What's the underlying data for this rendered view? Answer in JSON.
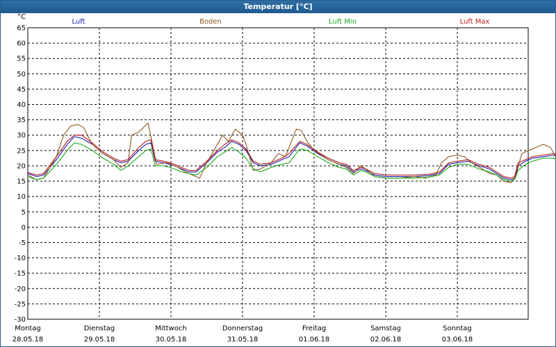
{
  "window": {
    "title": "Temperatur [°C]"
  },
  "chart_data": {
    "type": "line",
    "unit": "°C",
    "ylim": [
      -30,
      65
    ],
    "yticks": [
      65,
      60,
      55,
      50,
      45,
      40,
      35,
      30,
      25,
      20,
      15,
      10,
      5,
      0,
      -5,
      -10,
      -15,
      -20,
      -25,
      -30
    ],
    "grid": true,
    "legend_position": "top",
    "x_days": [
      {
        "weekday": "Montag",
        "date": "28.05.18"
      },
      {
        "weekday": "Dienstag",
        "date": "29.05.18"
      },
      {
        "weekday": "Mittwoch",
        "date": "30.05.18"
      },
      {
        "weekday": "Donnerstag",
        "date": "31.05.18"
      },
      {
        "weekday": "Freitag",
        "date": "01.06.18"
      },
      {
        "weekday": "Samstag",
        "date": "02.06.18"
      },
      {
        "weekday": "Sonntag",
        "date": "03.06.18"
      }
    ],
    "series": [
      {
        "name": "Luft",
        "color": "#1a1aa8",
        "points": [
          [
            0,
            17.5
          ],
          [
            0.12,
            16.5
          ],
          [
            0.22,
            17
          ],
          [
            0.4,
            22
          ],
          [
            0.55,
            27
          ],
          [
            0.65,
            29.5
          ],
          [
            0.75,
            29
          ],
          [
            0.9,
            27
          ],
          [
            1.05,
            24
          ],
          [
            1.2,
            22
          ],
          [
            1.3,
            21
          ],
          [
            1.4,
            21.5
          ],
          [
            1.55,
            25
          ],
          [
            1.65,
            27
          ],
          [
            1.72,
            27.5
          ],
          [
            1.78,
            21.5
          ],
          [
            1.9,
            21
          ],
          [
            2.05,
            20
          ],
          [
            2.15,
            19
          ],
          [
            2.25,
            18
          ],
          [
            2.35,
            18
          ],
          [
            2.5,
            21
          ],
          [
            2.65,
            24.5
          ],
          [
            2.75,
            26
          ],
          [
            2.85,
            28
          ],
          [
            2.95,
            27
          ],
          [
            3.05,
            25
          ],
          [
            3.15,
            21
          ],
          [
            3.25,
            20
          ],
          [
            3.4,
            20.5
          ],
          [
            3.55,
            22
          ],
          [
            3.65,
            23
          ],
          [
            3.8,
            27.5
          ],
          [
            3.9,
            26.5
          ],
          [
            4.05,
            24
          ],
          [
            4.2,
            22
          ],
          [
            4.35,
            20.5
          ],
          [
            4.45,
            20
          ],
          [
            4.55,
            18
          ],
          [
            4.65,
            19
          ],
          [
            4.72,
            18.5
          ],
          [
            4.85,
            17
          ],
          [
            5.0,
            16.5
          ],
          [
            5.2,
            16.5
          ],
          [
            5.4,
            16.5
          ],
          [
            5.6,
            16.8
          ],
          [
            5.75,
            17.5
          ],
          [
            5.88,
            20.5
          ],
          [
            6.0,
            21
          ],
          [
            6.15,
            21.5
          ],
          [
            6.3,
            20
          ],
          [
            6.45,
            19
          ],
          [
            6.55,
            17.5
          ],
          [
            6.65,
            16
          ],
          [
            6.75,
            15.5
          ],
          [
            6.8,
            16
          ],
          [
            6.85,
            20
          ],
          [
            6.95,
            21.5
          ],
          [
            7.05,
            22.5
          ],
          [
            7.2,
            23
          ],
          [
            7.35,
            23.5
          ],
          [
            7.45,
            22
          ],
          [
            7.55,
            20.5
          ],
          [
            7.6,
            20
          ]
        ]
      },
      {
        "name": "Boden",
        "color": "#8c5a1e",
        "points": [
          [
            0,
            17
          ],
          [
            0.12,
            15.5
          ],
          [
            0.22,
            16
          ],
          [
            0.4,
            23
          ],
          [
            0.5,
            30
          ],
          [
            0.6,
            33
          ],
          [
            0.7,
            33.5
          ],
          [
            0.78,
            32.5
          ],
          [
            0.9,
            27
          ],
          [
            1.05,
            24
          ],
          [
            1.2,
            22
          ],
          [
            1.3,
            19.5
          ],
          [
            1.4,
            21
          ],
          [
            1.45,
            30
          ],
          [
            1.55,
            31
          ],
          [
            1.68,
            34
          ],
          [
            1.75,
            26
          ],
          [
            1.8,
            20.5
          ],
          [
            1.95,
            21
          ],
          [
            2.1,
            19.5
          ],
          [
            2.2,
            18
          ],
          [
            2.3,
            17
          ],
          [
            2.4,
            16
          ],
          [
            2.5,
            21
          ],
          [
            2.6,
            25
          ],
          [
            2.72,
            30
          ],
          [
            2.8,
            28
          ],
          [
            2.9,
            32
          ],
          [
            3.0,
            30
          ],
          [
            3.05,
            27
          ],
          [
            3.15,
            18.5
          ],
          [
            3.25,
            19
          ],
          [
            3.4,
            21
          ],
          [
            3.5,
            24
          ],
          [
            3.6,
            23
          ],
          [
            3.65,
            26
          ],
          [
            3.75,
            32
          ],
          [
            3.82,
            31.5
          ],
          [
            3.9,
            28
          ],
          [
            4.0,
            25
          ],
          [
            4.2,
            22
          ],
          [
            4.35,
            20.5
          ],
          [
            4.45,
            19.5
          ],
          [
            4.55,
            17.5
          ],
          [
            4.65,
            20
          ],
          [
            4.72,
            19
          ],
          [
            4.85,
            16.5
          ],
          [
            5.0,
            16
          ],
          [
            5.2,
            16
          ],
          [
            5.4,
            16.5
          ],
          [
            5.55,
            16
          ],
          [
            5.7,
            17
          ],
          [
            5.78,
            21
          ],
          [
            5.88,
            23
          ],
          [
            6.0,
            23.5
          ],
          [
            6.1,
            23
          ],
          [
            6.2,
            21
          ],
          [
            6.35,
            19
          ],
          [
            6.45,
            17.5
          ],
          [
            6.55,
            17
          ],
          [
            6.65,
            15
          ],
          [
            6.75,
            14.5
          ],
          [
            6.82,
            17
          ],
          [
            6.9,
            24
          ],
          [
            7.0,
            25
          ],
          [
            7.1,
            26
          ],
          [
            7.2,
            27
          ],
          [
            7.3,
            26
          ],
          [
            7.4,
            22
          ],
          [
            7.5,
            18
          ],
          [
            7.6,
            17
          ]
        ]
      },
      {
        "name": "Luft Min",
        "color": "#1aa81a",
        "points": [
          [
            0,
            16.5
          ],
          [
            0.12,
            15.5
          ],
          [
            0.22,
            16
          ],
          [
            0.4,
            20.5
          ],
          [
            0.55,
            25
          ],
          [
            0.65,
            27.5
          ],
          [
            0.75,
            27
          ],
          [
            0.9,
            25
          ],
          [
            1.05,
            22.5
          ],
          [
            1.2,
            20.5
          ],
          [
            1.3,
            18.5
          ],
          [
            1.4,
            20
          ],
          [
            1.55,
            23
          ],
          [
            1.65,
            25
          ],
          [
            1.72,
            25.5
          ],
          [
            1.78,
            20
          ],
          [
            1.9,
            20
          ],
          [
            2.05,
            19
          ],
          [
            2.15,
            18
          ],
          [
            2.25,
            17.5
          ],
          [
            2.35,
            17
          ],
          [
            2.5,
            19.5
          ],
          [
            2.65,
            23
          ],
          [
            2.75,
            24.5
          ],
          [
            2.85,
            26
          ],
          [
            2.95,
            24.5
          ],
          [
            3.05,
            22.5
          ],
          [
            3.15,
            19
          ],
          [
            3.25,
            18
          ],
          [
            3.4,
            19.5
          ],
          [
            3.55,
            20.5
          ],
          [
            3.65,
            21
          ],
          [
            3.8,
            25.5
          ],
          [
            3.9,
            25
          ],
          [
            4.05,
            23
          ],
          [
            4.2,
            21
          ],
          [
            4.35,
            19.5
          ],
          [
            4.45,
            19
          ],
          [
            4.55,
            17
          ],
          [
            4.65,
            18.5
          ],
          [
            4.72,
            18
          ],
          [
            4.85,
            16.5
          ],
          [
            5.0,
            16
          ],
          [
            5.2,
            16
          ],
          [
            5.4,
            16
          ],
          [
            5.6,
            16.3
          ],
          [
            5.75,
            17
          ],
          [
            5.88,
            19.5
          ],
          [
            6.0,
            20.5
          ],
          [
            6.15,
            20.5
          ],
          [
            6.3,
            19
          ],
          [
            6.45,
            18
          ],
          [
            6.55,
            17
          ],
          [
            6.65,
            15.5
          ],
          [
            6.75,
            15
          ],
          [
            6.8,
            15.5
          ],
          [
            6.85,
            18.5
          ],
          [
            6.95,
            20.5
          ],
          [
            7.05,
            21.5
          ],
          [
            7.2,
            22.5
          ],
          [
            7.35,
            22.5
          ],
          [
            7.45,
            21
          ],
          [
            7.55,
            19.5
          ],
          [
            7.6,
            19
          ]
        ]
      },
      {
        "name": "Luft Max",
        "color": "#b81a1a",
        "points": [
          [
            0,
            17.8
          ],
          [
            0.12,
            17
          ],
          [
            0.22,
            17.5
          ],
          [
            0.4,
            23
          ],
          [
            0.55,
            28
          ],
          [
            0.65,
            30
          ],
          [
            0.75,
            30
          ],
          [
            0.9,
            27.5
          ],
          [
            1.05,
            24.5
          ],
          [
            1.2,
            22.5
          ],
          [
            1.3,
            21.5
          ],
          [
            1.4,
            22
          ],
          [
            1.55,
            26
          ],
          [
            1.65,
            28
          ],
          [
            1.72,
            28.5
          ],
          [
            1.78,
            22
          ],
          [
            1.9,
            21.5
          ],
          [
            2.05,
            20.5
          ],
          [
            2.15,
            19.5
          ],
          [
            2.25,
            18.5
          ],
          [
            2.35,
            18.5
          ],
          [
            2.5,
            21.5
          ],
          [
            2.65,
            25
          ],
          [
            2.75,
            27
          ],
          [
            2.85,
            28.5
          ],
          [
            2.95,
            27.5
          ],
          [
            3.05,
            25.5
          ],
          [
            3.15,
            21.5
          ],
          [
            3.25,
            20.5
          ],
          [
            3.4,
            21
          ],
          [
            3.55,
            22.5
          ],
          [
            3.65,
            24
          ],
          [
            3.8,
            28
          ],
          [
            3.9,
            27
          ],
          [
            4.05,
            24.5
          ],
          [
            4.2,
            22.5
          ],
          [
            4.35,
            21
          ],
          [
            4.45,
            20.5
          ],
          [
            4.55,
            18.5
          ],
          [
            4.65,
            19.5
          ],
          [
            4.72,
            19
          ],
          [
            4.85,
            17.5
          ],
          [
            5.0,
            17
          ],
          [
            5.2,
            17
          ],
          [
            5.4,
            17
          ],
          [
            5.6,
            17.2
          ],
          [
            5.75,
            18
          ],
          [
            5.88,
            21
          ],
          [
            6.0,
            21.5
          ],
          [
            6.15,
            22
          ],
          [
            6.3,
            20.5
          ],
          [
            6.45,
            19.5
          ],
          [
            6.55,
            18
          ],
          [
            6.65,
            16.5
          ],
          [
            6.75,
            16
          ],
          [
            6.8,
            16.5
          ],
          [
            6.85,
            21
          ],
          [
            6.95,
            22
          ],
          [
            7.05,
            23
          ],
          [
            7.2,
            23.5
          ],
          [
            7.35,
            24
          ],
          [
            7.45,
            22.5
          ],
          [
            7.55,
            21
          ],
          [
            7.6,
            20.5
          ]
        ]
      }
    ]
  }
}
